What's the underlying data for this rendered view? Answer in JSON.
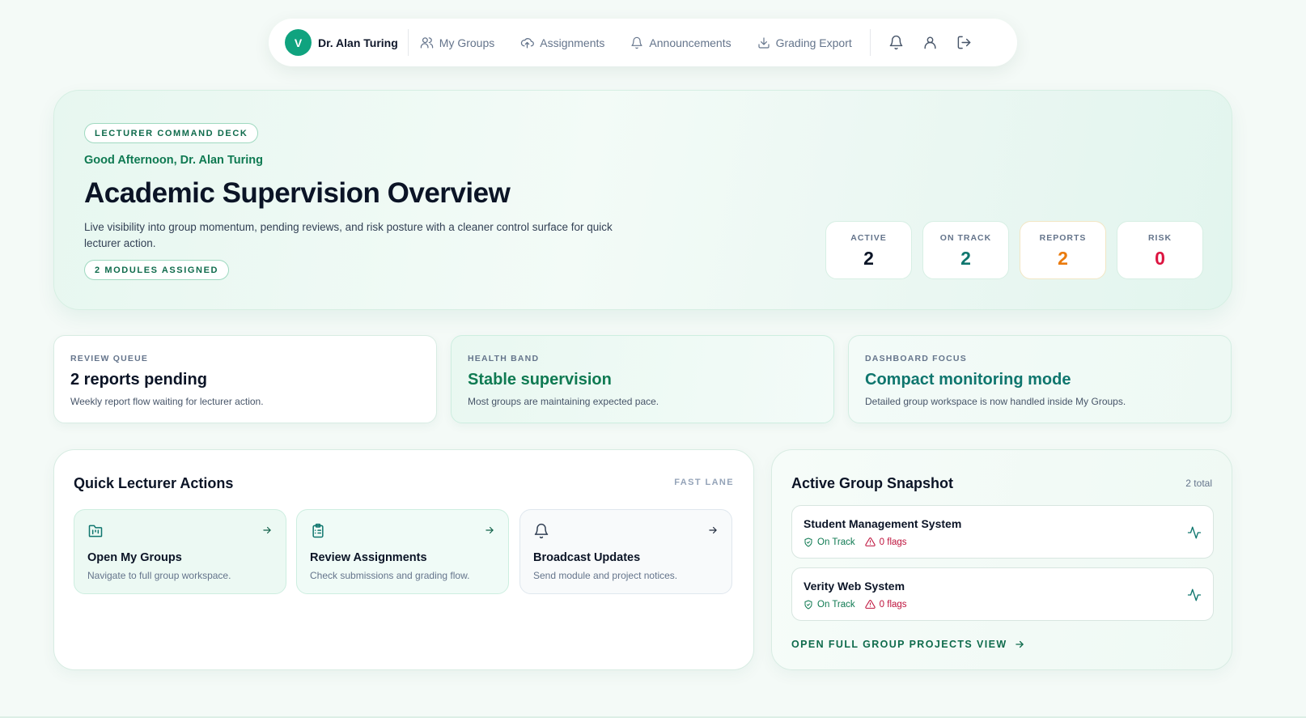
{
  "nav": {
    "avatar_letter": "V",
    "user_name": "Dr. Alan Turing",
    "items": [
      {
        "label": "My Groups",
        "icon": "users-icon"
      },
      {
        "label": "Assignments",
        "icon": "cloud-upload-icon"
      },
      {
        "label": "Announcements",
        "icon": "bell-icon"
      },
      {
        "label": "Grading Export",
        "icon": "download-icon"
      }
    ],
    "actions": [
      "bell-icon",
      "user-icon",
      "logout-icon"
    ]
  },
  "hero": {
    "badge": "LECTURER COMMAND DECK",
    "greeting": "Good Afternoon, Dr. Alan Turing",
    "title": "Academic Supervision Overview",
    "description": "Live visibility into group momentum, pending reviews, and risk posture with a cleaner control surface for quick lecturer action.",
    "modules_badge": "2 MODULES ASSIGNED",
    "stats": [
      {
        "label": "ACTIVE",
        "value": "2",
        "color": "#0b1426"
      },
      {
        "label": "ON TRACK",
        "value": "2",
        "color": "#0f766e"
      },
      {
        "label": "REPORTS",
        "value": "2",
        "color": "#ea7a0c"
      },
      {
        "label": "RISK",
        "value": "0",
        "color": "#dc1440"
      }
    ]
  },
  "cards": [
    {
      "eyebrow": "REVIEW QUEUE",
      "heading": "2 reports pending",
      "text": "Weekly report flow waiting for lecturer action.",
      "color": "#0b1426"
    },
    {
      "eyebrow": "HEALTH BAND",
      "heading": "Stable supervision",
      "text": "Most groups are maintaining expected pace.",
      "color": "#0f7a52"
    },
    {
      "eyebrow": "DASHBOARD FOCUS",
      "heading": "Compact monitoring mode",
      "text": "Detailed group workspace is now handled inside My Groups.",
      "color": "#0f766e"
    }
  ],
  "quick_actions": {
    "title": "Quick Lecturer Actions",
    "tag": "FAST LANE",
    "items": [
      {
        "title": "Open My Groups",
        "desc": "Navigate to full group workspace.",
        "icon": "folder-kanban-icon"
      },
      {
        "title": "Review Assignments",
        "desc": "Check submissions and grading flow.",
        "icon": "clipboard-list-icon"
      },
      {
        "title": "Broadcast Updates",
        "desc": "Send module and project notices.",
        "icon": "bell-icon"
      }
    ]
  },
  "snapshot": {
    "title": "Active Group Snapshot",
    "count": "2 total",
    "groups": [
      {
        "name": "Student Management System",
        "status": "On Track",
        "flags": "0 flags"
      },
      {
        "name": "Verity Web System",
        "status": "On Track",
        "flags": "0 flags"
      }
    ],
    "link": "OPEN FULL GROUP PROJECTS VIEW"
  }
}
